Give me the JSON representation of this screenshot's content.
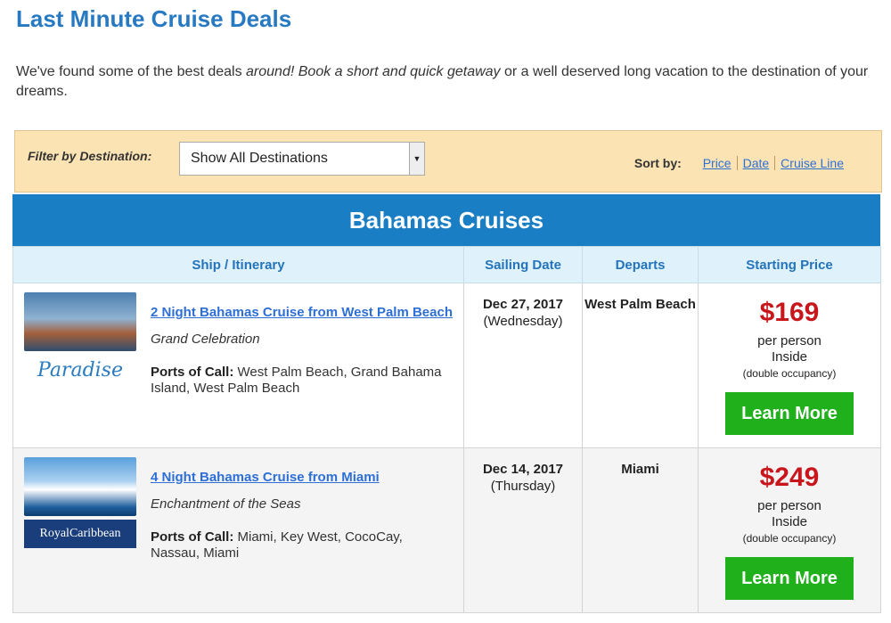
{
  "page": {
    "title": "Last Minute Cruise Deals",
    "intro_a": "We've found some of the best deals ",
    "intro_b": "around! Book a short and quick getaway",
    "intro_c": " or a well deserved long vacation to the destination of your dreams."
  },
  "filter": {
    "label": "Filter by Destination:",
    "selected": "Show All Destinations",
    "sort_label": "Sort by:",
    "sort_options": [
      "Price",
      "Date",
      "Cruise Line"
    ]
  },
  "section": {
    "title": "Bahamas Cruises"
  },
  "table": {
    "headers": [
      "Ship / Itinerary",
      "Sailing Date",
      "Departs",
      "Starting Price"
    ],
    "rows": [
      {
        "itinerary": "2 Night Bahamas Cruise from West Palm Beach",
        "ship": "Grand Celebration",
        "ports_label": "Ports of Call:",
        "ports": " West Palm Beach, Grand Bahama Island, West Palm Beach",
        "logo": "Paradise",
        "date": "Dec 27, 2017",
        "day": "(Wednesday)",
        "departs": "West Palm Beach",
        "price": "$169",
        "per": "per person",
        "cabin": "Inside",
        "occupancy": "(double occupancy)",
        "button": "Learn More"
      },
      {
        "itinerary": "4 Night Bahamas Cruise from Miami",
        "ship": "Enchantment of the Seas",
        "ports_label": "Ports of Call:",
        "ports": " Miami, Key West, CocoCay, Nassau, Miami",
        "logo": "RoyalCaribbean",
        "date": "Dec 14, 2017",
        "day": "(Thursday)",
        "departs": "Miami",
        "price": "$249",
        "per": "per person",
        "cabin": "Inside",
        "occupancy": "(double occupancy)",
        "button": "Learn More"
      }
    ]
  }
}
